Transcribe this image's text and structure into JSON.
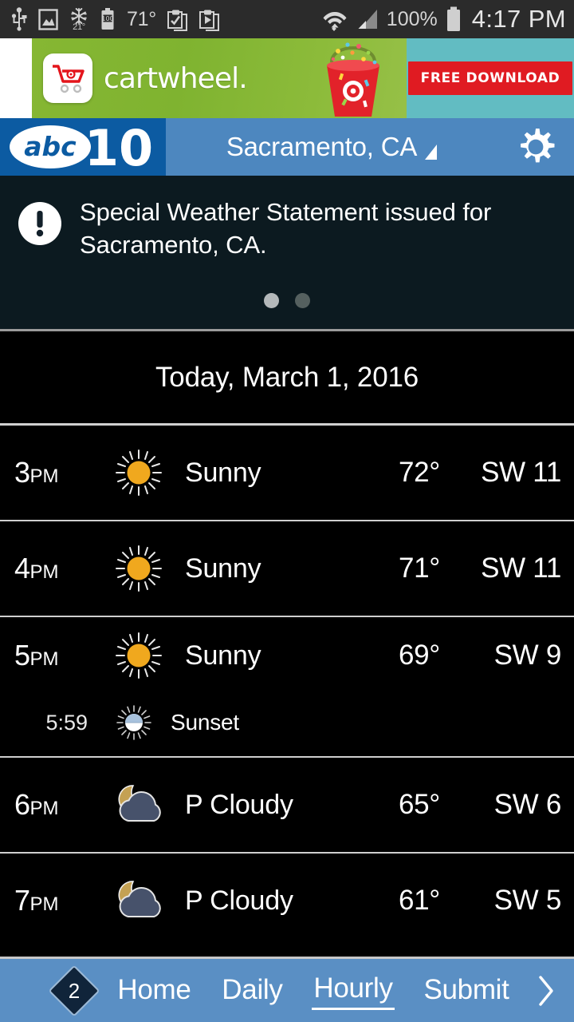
{
  "status_bar": {
    "icons": [
      "usb-icon",
      "screenshot-icon",
      "snowflake-icon",
      "battery-saver-icon",
      "clipboard-check-icon",
      "clipboard-play-icon",
      "wifi-icon",
      "cell-signal-icon"
    ],
    "snow_temp": "21",
    "snow_degree": "°",
    "temperature": "71°",
    "battery_text": "100",
    "battery_percent": "100%",
    "time": "4:17 PM"
  },
  "ad": {
    "name": "cartwheel-ad-banner",
    "brand": "cartwheel.",
    "cta_label": "FREE DOWNLOAD",
    "green_hex": "#86b733",
    "teal_hex": "#62bcc2",
    "cta_hex": "#e01b22"
  },
  "header": {
    "logo_text_abc": "abc",
    "logo_text_10": "10",
    "location": "Sacramento, CA",
    "logo_bg_hex": "#0c5ba2",
    "bar_bg_hex": "#4d87bf",
    "settings_icon": "gear-icon"
  },
  "alert": {
    "icon": "exclamation-circle-icon",
    "message": "Special Weather Statement issued for Sacramento, CA.",
    "pager": {
      "total": 2,
      "active_index": 0
    },
    "bg_hex": "#0c1a20"
  },
  "date_header": {
    "label": "Today, March 1, 2016"
  },
  "hourly": {
    "rows": [
      {
        "time": "3",
        "meridiem": "PM",
        "icon": "sun-icon",
        "condition": "Sunny",
        "temperature": "72°",
        "wind": "SW 11",
        "sub": null
      },
      {
        "time": "4",
        "meridiem": "PM",
        "icon": "sun-icon",
        "condition": "Sunny",
        "temperature": "71°",
        "wind": "SW 11",
        "sub": null
      },
      {
        "time": "5",
        "meridiem": "PM",
        "icon": "sun-icon",
        "condition": "Sunny",
        "temperature": "69°",
        "wind": "SW 9",
        "sub": {
          "time": "5:59",
          "icon": "sunset-icon",
          "label": "Sunset"
        }
      },
      {
        "time": "6",
        "meridiem": "PM",
        "icon": "moon-cloud-icon",
        "condition": "P Cloudy",
        "temperature": "65°",
        "wind": "SW 6",
        "sub": null
      },
      {
        "time": "7",
        "meridiem": "PM",
        "icon": "moon-cloud-icon",
        "condition": "P Cloudy",
        "temperature": "61°",
        "wind": "SW 5",
        "sub": null
      }
    ],
    "sun_hex": "#f0a81e",
    "moon_hex": "#c4a153",
    "cloud_hex": "#47526b"
  },
  "bottom_nav": {
    "badge_count": "2",
    "items": [
      {
        "label": "Home",
        "active": false
      },
      {
        "label": "Daily",
        "active": false
      },
      {
        "label": "Hourly",
        "active": true
      },
      {
        "label": "Submit",
        "active": false
      }
    ],
    "more_icon": "chevron-right-icon",
    "bg_hex": "#5a8fc4"
  }
}
